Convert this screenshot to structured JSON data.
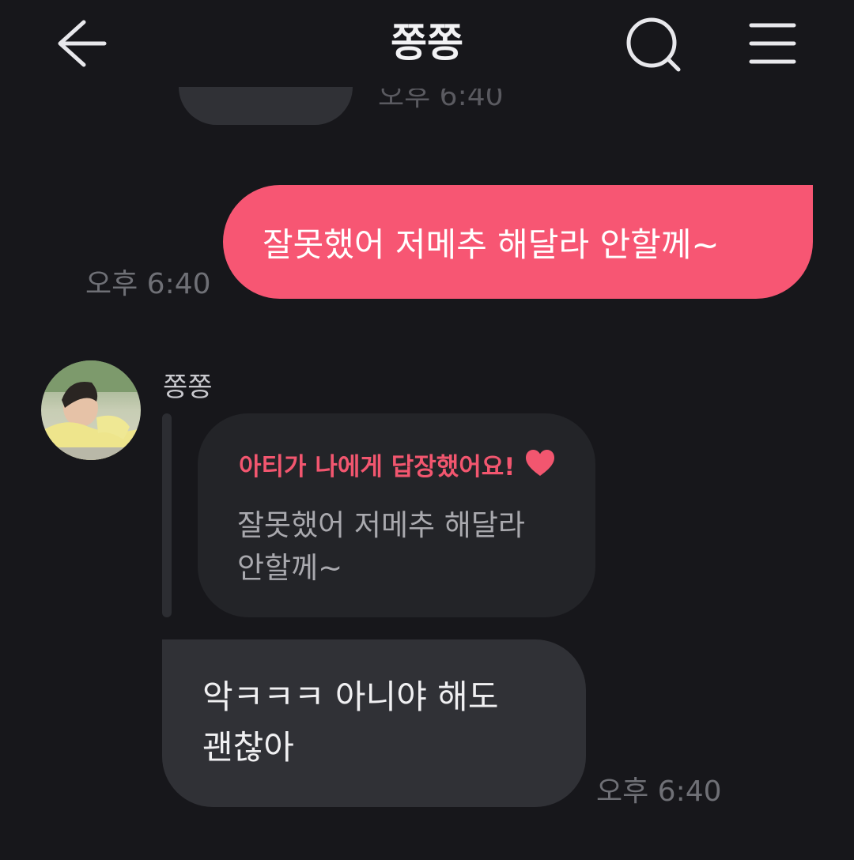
{
  "header": {
    "title": "쫑쫑",
    "back_icon": "arrow-left-icon",
    "search_icon": "search-icon",
    "menu_icon": "hamburger-menu-icon"
  },
  "messages": {
    "outgoing": {
      "text": "잘못했어 저메추 해달라 안할께~",
      "time": "오후 6:40",
      "color": "#f75673"
    },
    "incoming": {
      "sender": "쫑쫑",
      "reply_header": "아티가 나에게 답장했어요!",
      "reply_icon": "heart-icon",
      "reply_quote_line1": "잘못했어 저메추 해달라",
      "reply_quote_line2": "안할께~",
      "text_line1": "악ㅋㅋㅋ 아니야 해도",
      "text_line2": "괜찮아",
      "time": "오후 6:40",
      "accent_color": "#f2566f"
    }
  }
}
